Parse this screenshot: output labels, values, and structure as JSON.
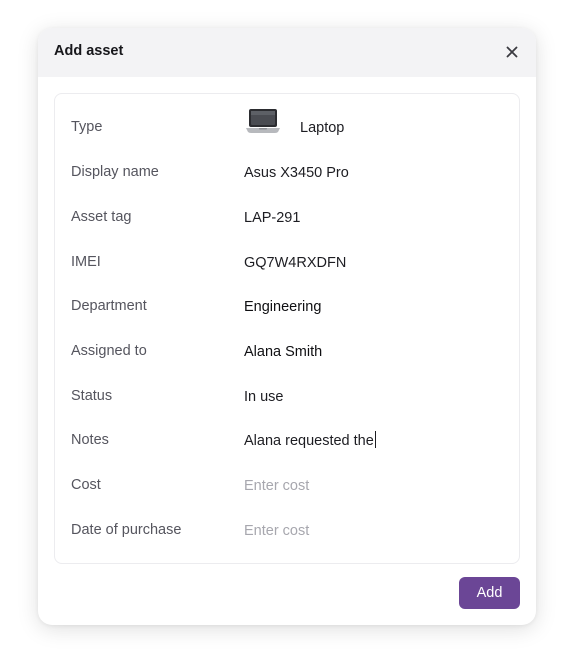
{
  "dialog": {
    "title": "Add asset",
    "close_icon": "close-icon",
    "add_label": "Add",
    "accent_color": "#6b4696"
  },
  "fields": {
    "type": {
      "label": "Type",
      "value": "Laptop",
      "icon": "laptop-icon"
    },
    "display_name": {
      "label": "Display name",
      "value": "Asus X3450 Pro"
    },
    "asset_tag": {
      "label": "Asset tag",
      "value": "LAP-291"
    },
    "imei": {
      "label": "IMEI",
      "value": "GQ7W4RXDFN"
    },
    "department": {
      "label": "Department",
      "value": "Engineering"
    },
    "assigned_to": {
      "label": "Assigned to",
      "value": "Alana Smith"
    },
    "status": {
      "label": "Status",
      "value": "In use"
    },
    "notes": {
      "label": "Notes",
      "value": "Alana requested the"
    },
    "cost": {
      "label": "Cost",
      "value": "",
      "placeholder": "Enter cost"
    },
    "date_of_purchase": {
      "label": "Date of purchase",
      "value": "",
      "placeholder": "Enter cost"
    }
  }
}
